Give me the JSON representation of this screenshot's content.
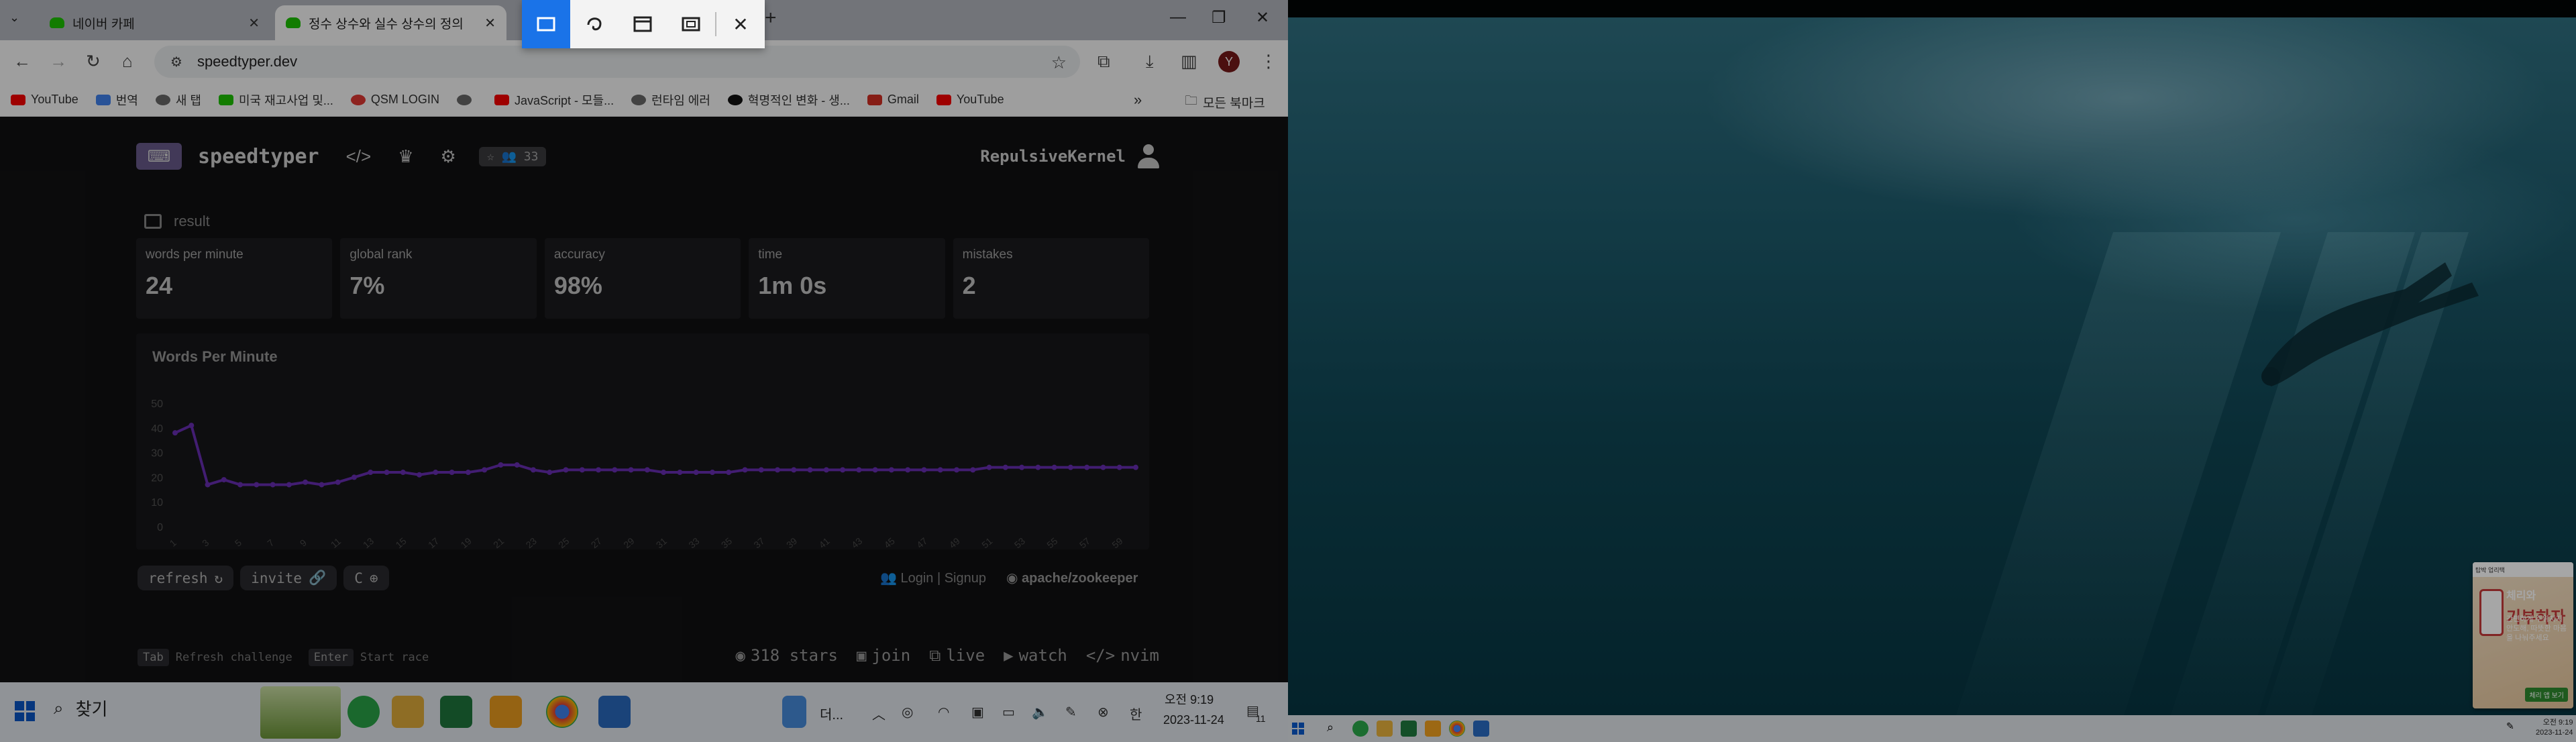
{
  "browser": {
    "tabs": [
      {
        "title": "네이버 카페",
        "active": false
      },
      {
        "title": "정수 상수와 실수 상수의 정의",
        "active": true
      }
    ],
    "url": "speedtyper.dev",
    "profile_initial": "Y",
    "bookmarks": [
      {
        "label": "YouTube",
        "color": "#ff0000"
      },
      {
        "label": "번역",
        "color": "#4285f4"
      },
      {
        "label": "새 탭",
        "color": "#6b6b6b"
      },
      {
        "label": "미국 재고사업 및...",
        "color": "#1ec800"
      },
      {
        "label": "QSM LOGIN",
        "color": "#e53935"
      },
      {
        "label": "",
        "color": "#6b6b6b"
      },
      {
        "label": "JavaScript - 모들...",
        "color": "#ff0000"
      },
      {
        "label": "런타임 에러",
        "color": "#6b6b6b"
      },
      {
        "label": "혁명적인 변화 - 생...",
        "color": "#111111"
      },
      {
        "label": "Gmail",
        "color": "#d93025"
      },
      {
        "label": "YouTube",
        "color": "#ff0000"
      }
    ],
    "all_bookmarks": "모든 북마크"
  },
  "snip_toolbar": {
    "modes": [
      "rectangle-snip-icon",
      "freeform-snip-icon",
      "window-snip-icon",
      "fullscreen-snip-icon"
    ],
    "close": "✕"
  },
  "app": {
    "name": "speedtyper",
    "badge": "☆ 👥 33",
    "username": "RepulsiveKernel",
    "result_label": "result",
    "stats": [
      {
        "label": "words per minute",
        "value": "24"
      },
      {
        "label": "global rank",
        "value": "7%"
      },
      {
        "label": "accuracy",
        "value": "98%"
      },
      {
        "label": "time",
        "value": "1m 0s"
      },
      {
        "label": "mistakes",
        "value": "2"
      }
    ],
    "actions": {
      "refresh": "refresh",
      "invite": "invite",
      "language": "C"
    },
    "auth_label": "Login | Signup",
    "repo": "apache/zookeeper",
    "footer": {
      "tab_key": "Tab",
      "tab_hint": "Refresh challenge",
      "enter_key": "Enter",
      "enter_hint": "Start race",
      "links": [
        "318 stars",
        "join",
        "live",
        "watch",
        "nvim"
      ]
    }
  },
  "chart_data": {
    "type": "line",
    "title": "Words Per Minute",
    "ylim": [
      0,
      50
    ],
    "y_ticks": [
      0,
      10,
      20,
      30,
      40,
      50
    ],
    "x": [
      1,
      2,
      3,
      4,
      5,
      6,
      7,
      8,
      9,
      10,
      11,
      12,
      13,
      14,
      15,
      16,
      17,
      18,
      19,
      20,
      21,
      22,
      23,
      24,
      25,
      26,
      27,
      28,
      29,
      30,
      31,
      32,
      33,
      34,
      35,
      36,
      37,
      38,
      39,
      40,
      41,
      42,
      43,
      44,
      45,
      46,
      47,
      48,
      49,
      50,
      51,
      52,
      53,
      54,
      55,
      56,
      57,
      58,
      59,
      60
    ],
    "x_tick_labels": [
      "1",
      "3",
      "5",
      "7",
      "9",
      "11",
      "13",
      "15",
      "17",
      "19",
      "21",
      "23",
      "25",
      "27",
      "29",
      "31",
      "33",
      "35",
      "37",
      "39",
      "41",
      "43",
      "45",
      "47",
      "49",
      "51",
      "53",
      "55",
      "57",
      "59"
    ],
    "series": [
      {
        "values": [
          38,
          41,
          17,
          19,
          17,
          17,
          17,
          17,
          18,
          17,
          18,
          20,
          22,
          22,
          22,
          21,
          22,
          22,
          22,
          23,
          25,
          25,
          23,
          22,
          23,
          23,
          23,
          23,
          23,
          23,
          22,
          22,
          22,
          22,
          22,
          23,
          23,
          23,
          23,
          23,
          23,
          23,
          23,
          23,
          23,
          23,
          23,
          23,
          23,
          23,
          24,
          24,
          24,
          24,
          24,
          24,
          24,
          24,
          24,
          24
        ],
        "color": "#6b2fb8"
      }
    ],
    "grid": false
  },
  "taskbar_left": {
    "search_label": "찾기",
    "browser_label": "더...",
    "time": "오전 9:19",
    "date": "2023-11-24",
    "notif_count": "11"
  },
  "right_screen": {
    "promo": {
      "top": "탑박 업리택",
      "title_a": "체리와",
      "title_b": "기부하자",
      "sub": "간편하게 주위지지 안도해, 따뜻한 마음을 나눠주세요",
      "button": "체리 앱 보기"
    },
    "time": "오전 9:19",
    "date": "2023-11-24"
  }
}
